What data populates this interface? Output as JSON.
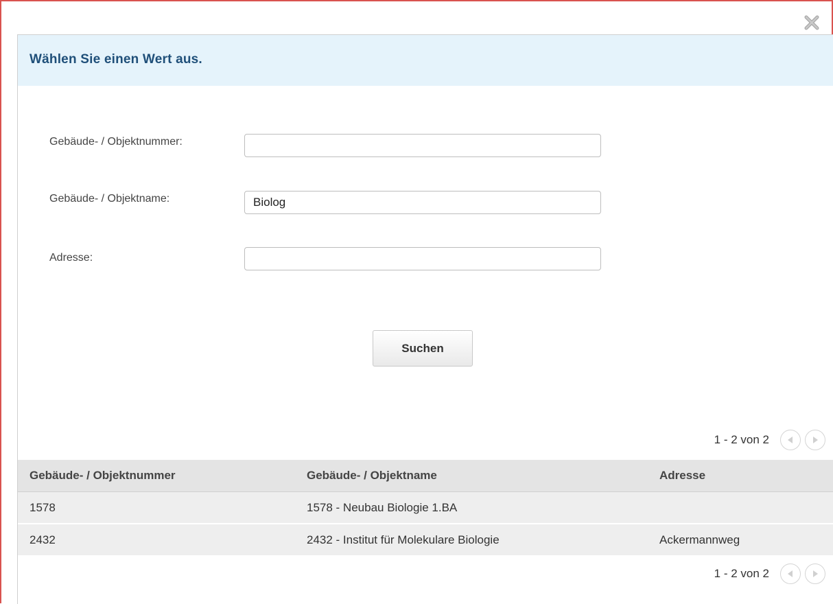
{
  "dialog": {
    "title": "Wählen Sie einen Wert aus."
  },
  "form": {
    "fields": [
      {
        "label": "Gebäude- / Objektnummer:",
        "value": ""
      },
      {
        "label": "Gebäude- / Objektname:",
        "value": "Biolog"
      },
      {
        "label": "Adresse:",
        "value": ""
      }
    ],
    "search_label": "Suchen"
  },
  "pager": {
    "text": "1 - 2 von 2"
  },
  "table": {
    "headers": [
      "Gebäude- / Objektnummer",
      "Gebäude- / Objektname",
      "Adresse"
    ],
    "rows": [
      [
        "1578",
        "1578 - Neubau Biologie 1.BA",
        ""
      ],
      [
        "2432",
        "2432 - Institut für Molekulare Biologie",
        "Ackermannweg"
      ]
    ]
  },
  "colors": {
    "header_bg": "#e5f3fb",
    "title": "#1f4f79",
    "frame": "#d9534f"
  }
}
